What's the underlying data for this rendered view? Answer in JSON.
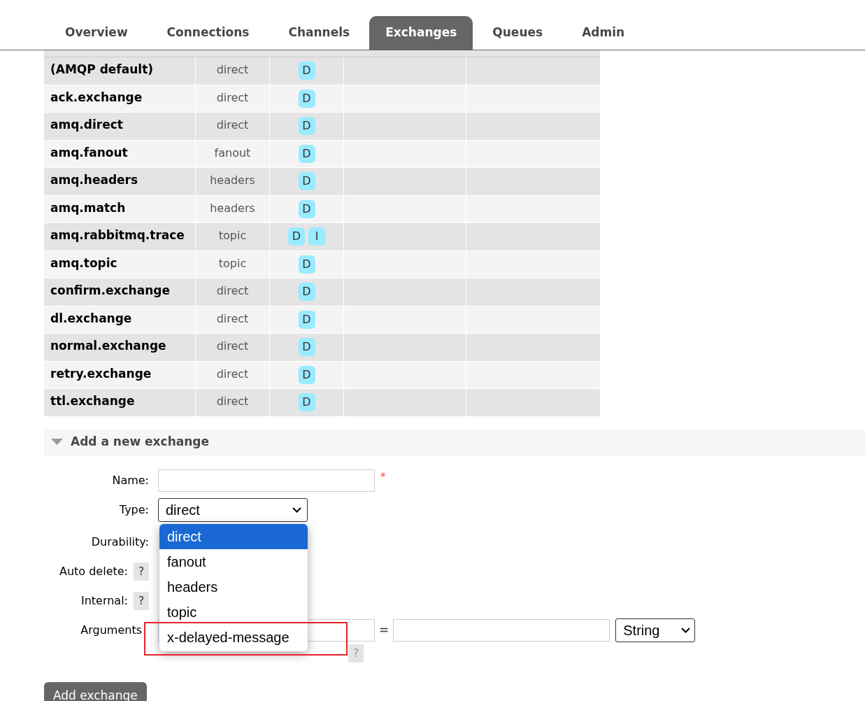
{
  "tabs": [
    {
      "label": "Overview",
      "selected": false
    },
    {
      "label": "Connections",
      "selected": false
    },
    {
      "label": "Channels",
      "selected": false
    },
    {
      "label": "Exchanges",
      "selected": true
    },
    {
      "label": "Queues",
      "selected": false
    },
    {
      "label": "Admin",
      "selected": false
    }
  ],
  "exchanges": [
    {
      "name": "(AMQP default)",
      "type": "direct",
      "features": [
        "D"
      ]
    },
    {
      "name": "ack.exchange",
      "type": "direct",
      "features": [
        "D"
      ]
    },
    {
      "name": "amq.direct",
      "type": "direct",
      "features": [
        "D"
      ]
    },
    {
      "name": "amq.fanout",
      "type": "fanout",
      "features": [
        "D"
      ]
    },
    {
      "name": "amq.headers",
      "type": "headers",
      "features": [
        "D"
      ]
    },
    {
      "name": "amq.match",
      "type": "headers",
      "features": [
        "D"
      ]
    },
    {
      "name": "amq.rabbitmq.trace",
      "type": "topic",
      "features": [
        "D",
        "I"
      ]
    },
    {
      "name": "amq.topic",
      "type": "topic",
      "features": [
        "D"
      ]
    },
    {
      "name": "confirm.exchange",
      "type": "direct",
      "features": [
        "D"
      ]
    },
    {
      "name": "dl.exchange",
      "type": "direct",
      "features": [
        "D"
      ]
    },
    {
      "name": "normal.exchange",
      "type": "direct",
      "features": [
        "D"
      ]
    },
    {
      "name": "retry.exchange",
      "type": "direct",
      "features": [
        "D"
      ]
    },
    {
      "name": "ttl.exchange",
      "type": "direct",
      "features": [
        "D"
      ]
    }
  ],
  "add_section": {
    "title": "Add a new exchange",
    "expanded": true,
    "name_label": "Name:",
    "required_mark": "*",
    "type_label": "Type:",
    "type_value": "direct",
    "type_options": [
      {
        "label": "direct",
        "selected": true
      },
      {
        "label": "fanout",
        "selected": false
      },
      {
        "label": "headers",
        "selected": false
      },
      {
        "label": "topic",
        "selected": false
      },
      {
        "label": "x-delayed-message",
        "selected": false
      }
    ],
    "durability_label": "Durability:",
    "auto_delete_label": "Auto delete:",
    "internal_label": "Internal:",
    "help": "?",
    "arguments_label": "Arguments",
    "equals": "=",
    "argument_type": "String",
    "submit": "Add exchange"
  }
}
